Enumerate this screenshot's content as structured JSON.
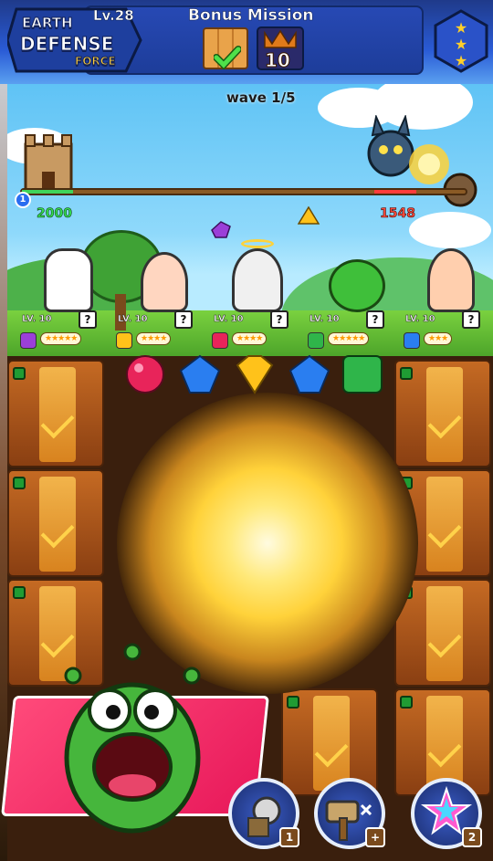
{
  "logo": {
    "line1": "EARTH",
    "line2": "DEFENSE",
    "line3": "FORCE"
  },
  "hud": {
    "level": "Lv.28",
    "mission_title": "Bonus Mission",
    "target_count": "10",
    "stars_icon": "three-stars-icon"
  },
  "battle": {
    "wave": "wave 1/5",
    "player_hp": "2000",
    "enemy_hp": "1548",
    "wave_marker": "1"
  },
  "heroes": [
    {
      "level": "LV. 10",
      "help": "?",
      "gem": "purple",
      "stars": "★★★★★"
    },
    {
      "level": "LV. 10",
      "help": "?",
      "gem": "yellow",
      "stars": "★★★★"
    },
    {
      "level": "LV. 10",
      "help": "?",
      "gem": "red",
      "stars": "★★★★"
    },
    {
      "level": "LV. 10",
      "help": "?",
      "gem": "green",
      "stars": "★★★★★"
    },
    {
      "level": "LV. 10",
      "help": "?",
      "gem": "blue",
      "stars": "★★★"
    }
  ],
  "skills": [
    {
      "icon": "magnifier-shield-icon",
      "count": "1"
    },
    {
      "icon": "hammer-cross-icon",
      "count": "+"
    },
    {
      "icon": "rainbow-star-wand-icon",
      "count": "2"
    }
  ],
  "colors": {
    "gem_purple": "#9b3fd8",
    "gem_yellow": "#ffc21a",
    "gem_red": "#e8245a",
    "gem_green": "#2fb54a",
    "gem_blue": "#2a7ef0"
  }
}
